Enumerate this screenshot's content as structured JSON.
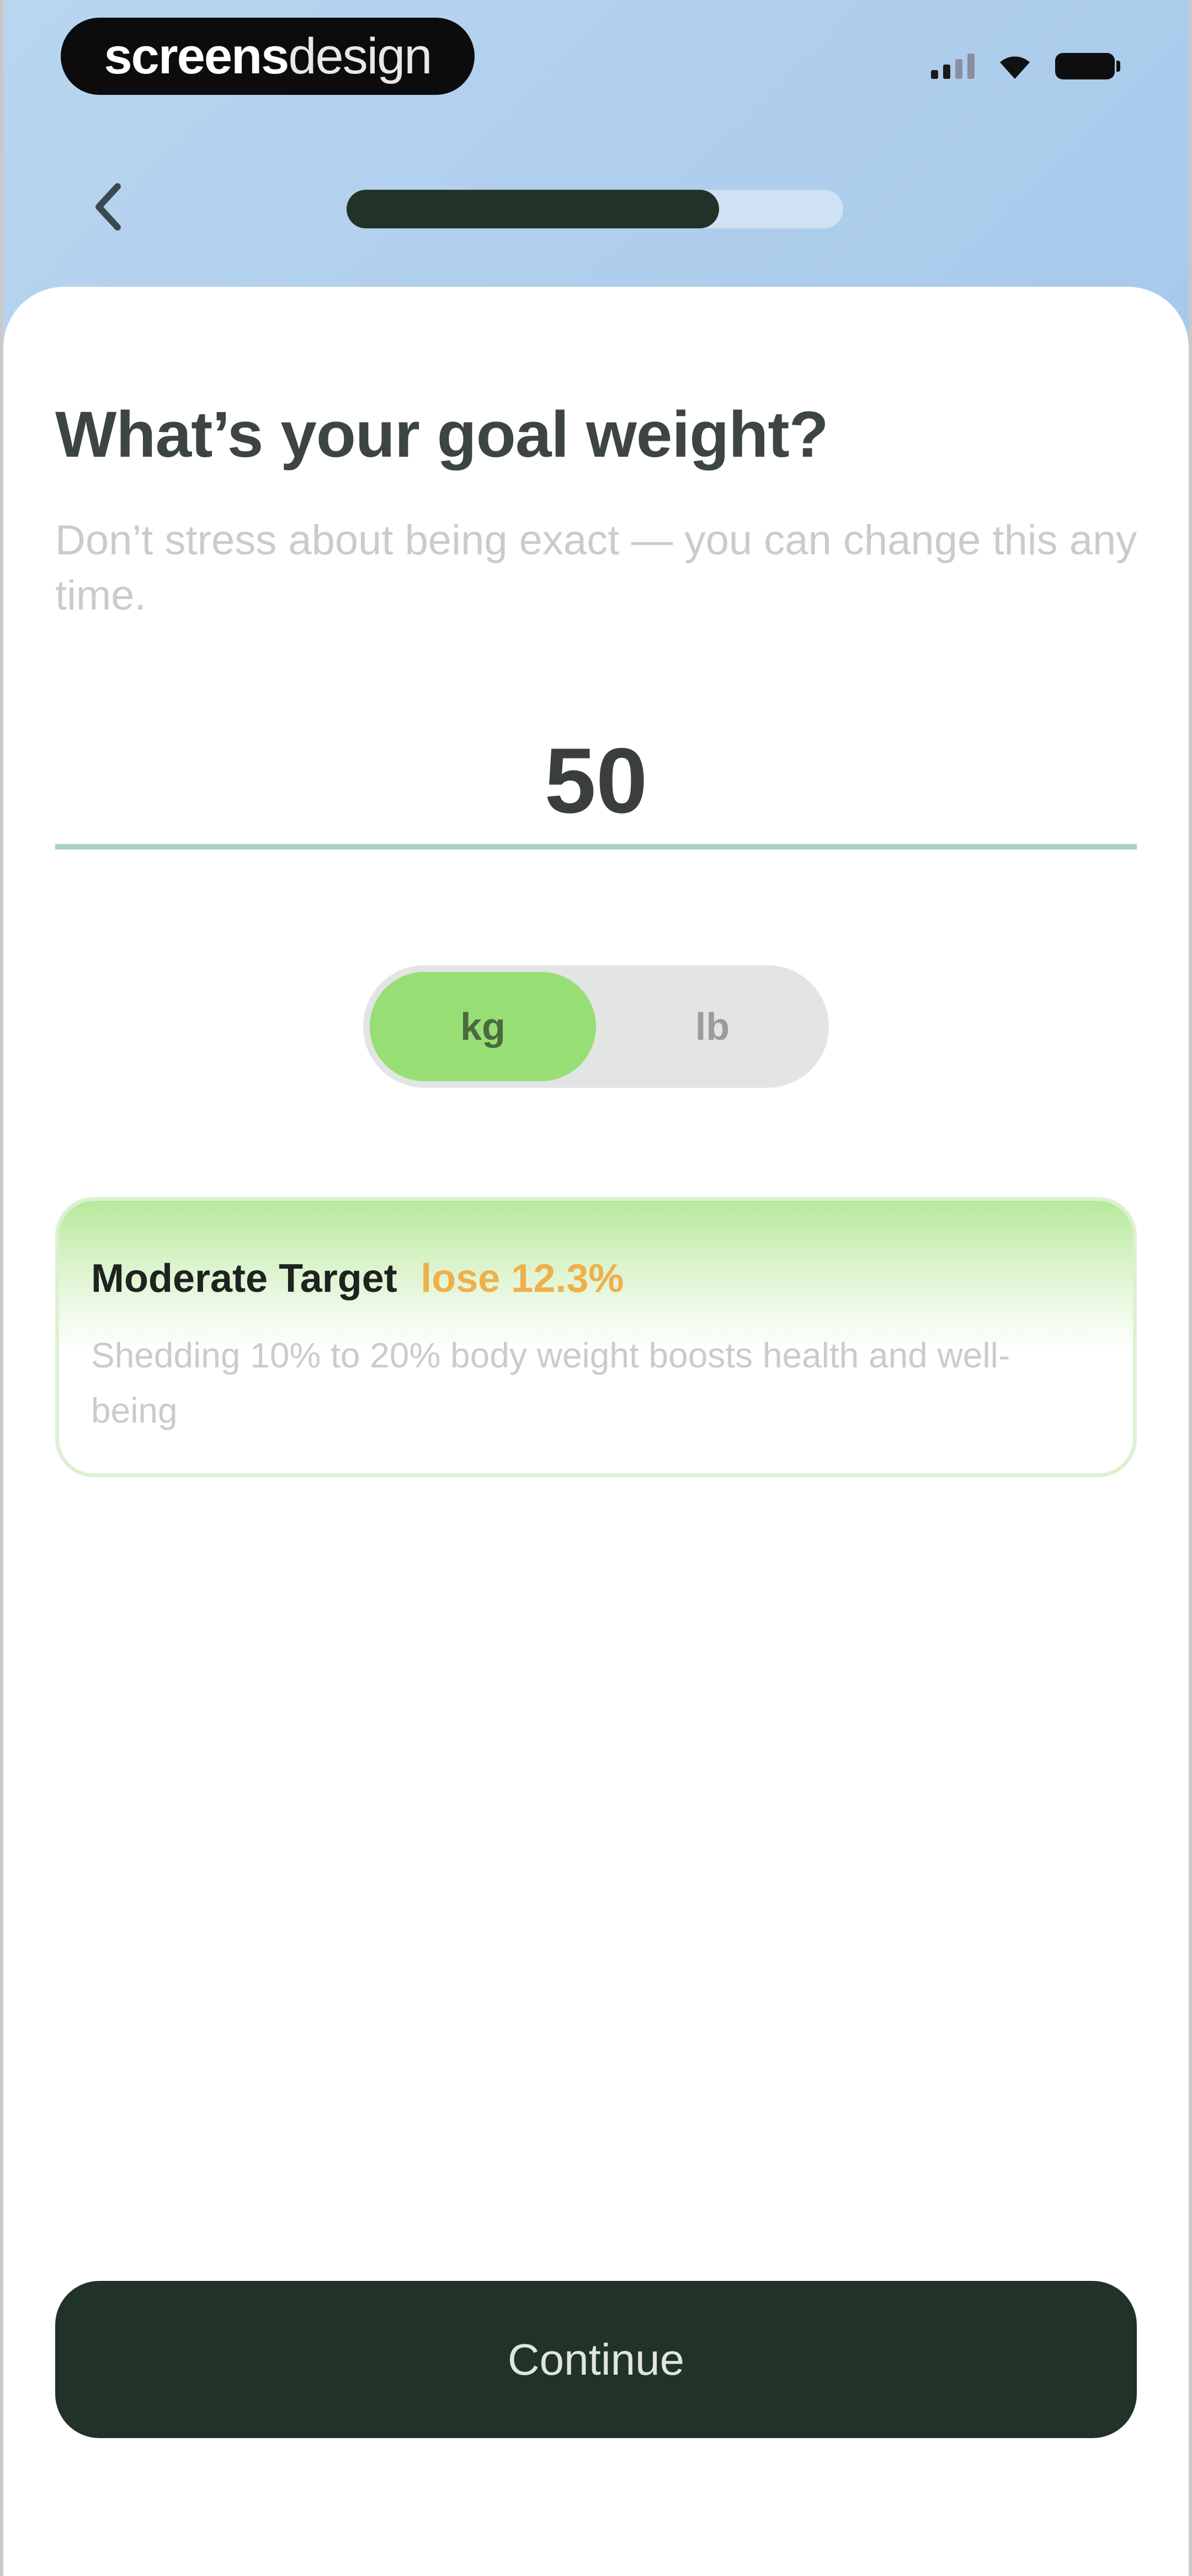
{
  "status_bar": {
    "brand_bold": "screens",
    "brand_light": "design",
    "icons": [
      "signal-icon",
      "wifi-icon",
      "battery-icon"
    ]
  },
  "nav": {
    "back_icon": "chevron-left-icon",
    "progress_fraction": 0.75
  },
  "header": {
    "title": "What’s your goal weight?",
    "subtitle": "Don’t stress about being exact — you can change this any time."
  },
  "weight": {
    "value": "50"
  },
  "units": {
    "options": [
      "kg",
      "lb"
    ],
    "selected": "kg"
  },
  "target": {
    "label": "Moderate Target",
    "percent": "lose 12.3%",
    "description": "Shedding 10% to 20% body weight boosts health and well-being"
  },
  "footer": {
    "continue_label": "Continue"
  },
  "colors": {
    "accent_green": "#97df74",
    "dark_green": "#213229",
    "warning_orange": "#efb04a",
    "input_underline": "#a8d3bf"
  }
}
